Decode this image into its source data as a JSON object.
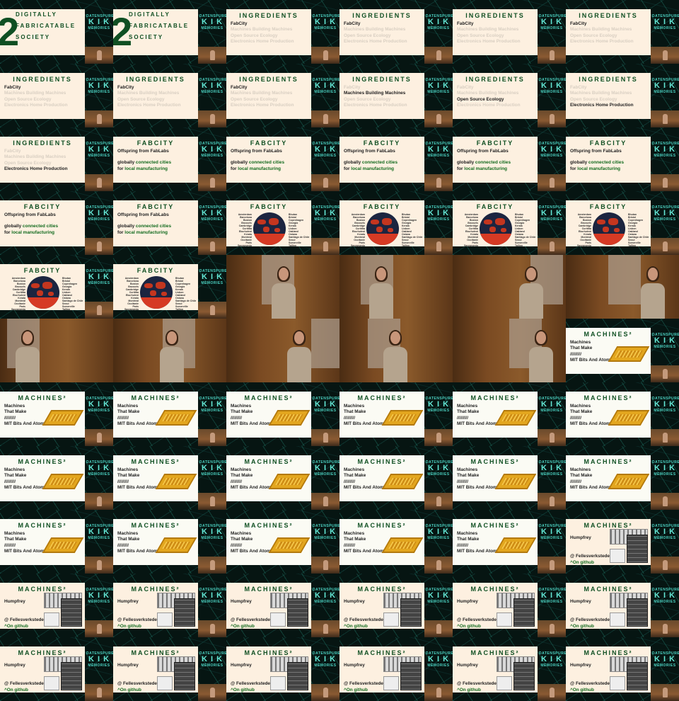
{
  "cover": {
    "number": "2",
    "lines": [
      "DIGITALLY",
      "FABRICATABLE",
      "SOCIETY"
    ]
  },
  "logo": {
    "top": "DATENSPUREN",
    "mid": "K I K",
    "bottom": "MEMORIES"
  },
  "ingredients": {
    "heading": "INGREDIENTS",
    "items": [
      "FabCity",
      "Machines Building Machines",
      "Open Source Ecology",
      "Electronics Home Production"
    ]
  },
  "fabcity": {
    "heading": "FABCITY",
    "subtitle": "Offspring from FabLabs",
    "line1_a": "globally ",
    "line1_b": "connected cities",
    "line2_a": "for ",
    "line2_b": "local manufacturing",
    "cities_left": [
      "Amsterdam",
      "Barcelona",
      "Boston",
      "Brussels",
      "Cambridge",
      "Curitiba",
      "Ekurhuleni",
      "Kerala",
      "Montreal",
      "Occitanie",
      "Paris",
      "Sacramento",
      "Santiago",
      "Shenzhen",
      "Toulouse"
    ],
    "cities_right": [
      "Bhutan",
      "Bristol",
      "Copenhagen",
      "Georgia",
      "Kerala",
      "Lisbon",
      "Oakland",
      "Ostana",
      "Santiago de Chile",
      "Seoul",
      "Somerville",
      "Tallinn",
      "Tokyo",
      "Toulouse",
      "Zurich"
    ]
  },
  "machines": {
    "heading": "MACHINES²",
    "lines": [
      "Machines",
      "That Make",
      "/////////",
      "MIT Bits And Atoms"
    ],
    "humpfrey": "Humpfrey",
    "at": "@ Fellesverkstedet",
    "github": "^On github"
  },
  "frames": [
    {
      "kind": "cover"
    },
    {
      "kind": "cover"
    },
    {
      "kind": "ingredients",
      "active": 0
    },
    {
      "kind": "ingredients",
      "active": 0
    },
    {
      "kind": "ingredients",
      "active": 0
    },
    {
      "kind": "ingredients",
      "active": 0
    },
    {
      "kind": "ingredients",
      "active": 0
    },
    {
      "kind": "ingredients",
      "active": 0
    },
    {
      "kind": "ingredients",
      "active": 0
    },
    {
      "kind": "ingredients",
      "active": 1
    },
    {
      "kind": "ingredients",
      "active": 2
    },
    {
      "kind": "ingredients",
      "active": 3
    },
    {
      "kind": "ingredients",
      "active": 3
    },
    {
      "kind": "fabcity"
    },
    {
      "kind": "fabcity"
    },
    {
      "kind": "fabcity"
    },
    {
      "kind": "fabcity"
    },
    {
      "kind": "fabcity"
    },
    {
      "kind": "fabcity"
    },
    {
      "kind": "fabcity"
    },
    {
      "kind": "fabmap"
    },
    {
      "kind": "fabmap"
    },
    {
      "kind": "fabmap"
    },
    {
      "kind": "fabmap"
    },
    {
      "kind": "fabmap"
    },
    {
      "kind": "fabmap"
    },
    {
      "kind": "photo"
    },
    {
      "kind": "photo"
    },
    {
      "kind": "photo"
    },
    {
      "kind": "photo"
    },
    {
      "kind": "photo"
    },
    {
      "kind": "photo"
    },
    {
      "kind": "photo"
    },
    {
      "kind": "photo"
    },
    {
      "kind": "photo"
    },
    {
      "kind": "machines"
    },
    {
      "kind": "machines"
    },
    {
      "kind": "machines"
    },
    {
      "kind": "machines"
    },
    {
      "kind": "machines"
    },
    {
      "kind": "machines"
    },
    {
      "kind": "machines"
    },
    {
      "kind": "machines"
    },
    {
      "kind": "machines"
    },
    {
      "kind": "machines"
    },
    {
      "kind": "machines"
    },
    {
      "kind": "machines"
    },
    {
      "kind": "machines"
    },
    {
      "kind": "machines"
    },
    {
      "kind": "machines"
    },
    {
      "kind": "machines"
    },
    {
      "kind": "machines"
    },
    {
      "kind": "machines"
    },
    {
      "kind": "humpfrey"
    },
    {
      "kind": "humpfrey"
    },
    {
      "kind": "humpfrey"
    },
    {
      "kind": "humpfrey"
    },
    {
      "kind": "humpfrey"
    },
    {
      "kind": "humpfrey"
    },
    {
      "kind": "humpfrey"
    },
    {
      "kind": "humpfrey"
    },
    {
      "kind": "humpfrey"
    },
    {
      "kind": "humpfrey"
    },
    {
      "kind": "humpfrey"
    },
    {
      "kind": "humpfrey"
    },
    {
      "kind": "humpfrey"
    }
  ]
}
